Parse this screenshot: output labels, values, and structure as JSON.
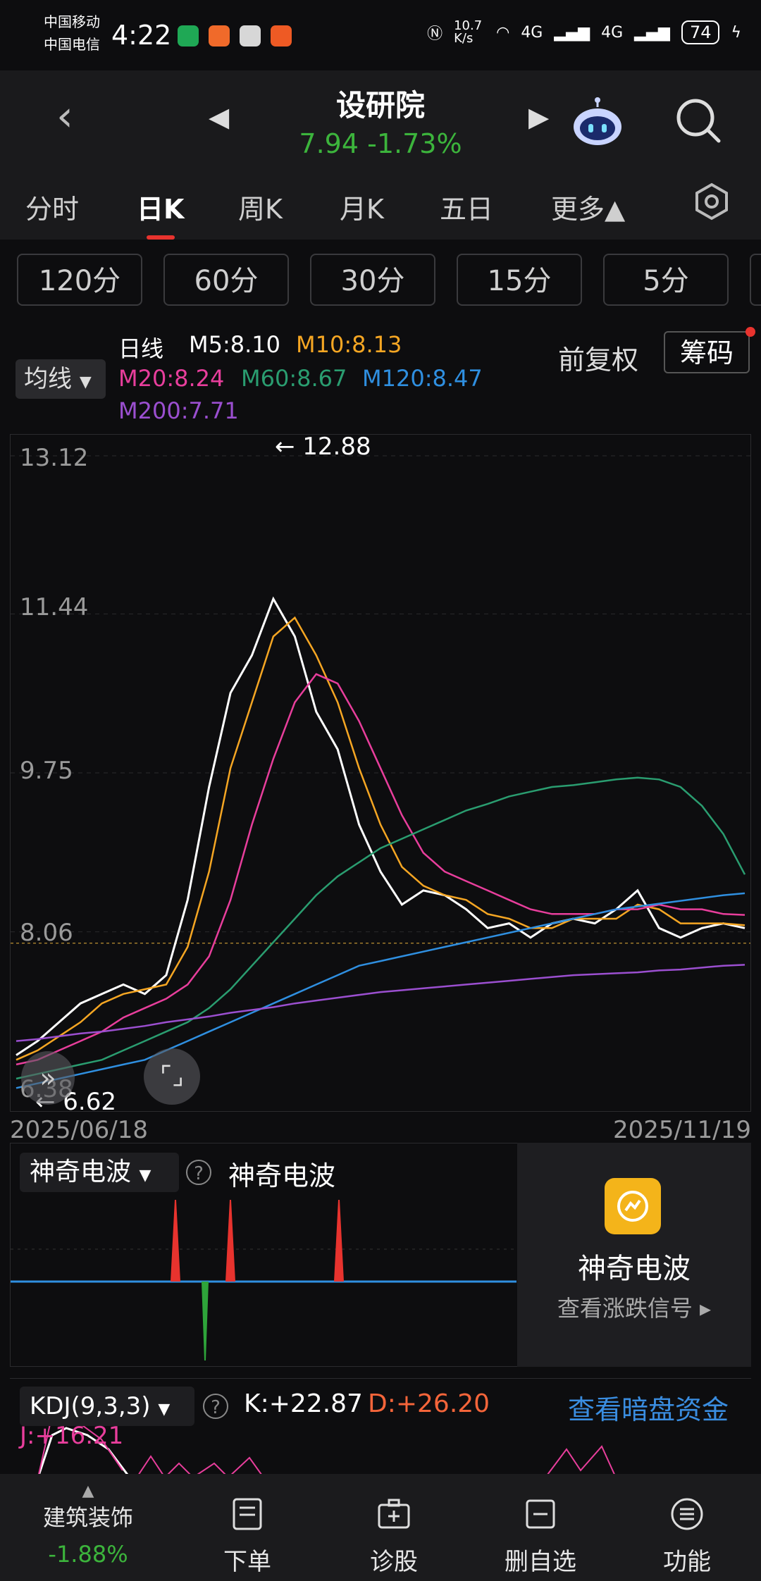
{
  "status_bar": {
    "carrier1": "中国移动",
    "carrier2": "中国电信",
    "time": "4:22",
    "net_speed": "10.7 K/s",
    "signal1": "4G",
    "signal2": "4G",
    "battery": "74"
  },
  "header": {
    "title": "设研院",
    "price": "7.94",
    "change": "-1.73%",
    "change_color": "#3cb43c"
  },
  "period_tabs": [
    "分时",
    "日K",
    "周K",
    "月K",
    "五日",
    "更多▲"
  ],
  "active_tab": "日K",
  "minute_buttons": [
    "120分",
    "60分",
    "30分",
    "15分",
    "5分"
  ],
  "legend": {
    "selector": "均线",
    "label": "日线",
    "m5": "M5:8.10",
    "m10": "M10:8.13",
    "m20": "M20:8.24",
    "m60": "M60:8.67",
    "m120": "M120:8.47",
    "m200": "M200:7.71",
    "adjust": "前复权",
    "chips": "筹码"
  },
  "chart_data": {
    "type": "line",
    "title": "",
    "y_ticks": [
      "13.12",
      "11.44",
      "9.75",
      "8.06",
      "6.38"
    ],
    "ylim": [
      6.38,
      13.12
    ],
    "x_start": "2025/06/18",
    "x_end": "2025/11/19",
    "high_annotation": "12.88",
    "low_annotation": "6.62",
    "last_price": 7.94,
    "series": [
      {
        "name": "M5",
        "color": "#ffffff",
        "values": [
          6.75,
          6.9,
          7.1,
          7.3,
          7.4,
          7.5,
          7.4,
          7.6,
          8.4,
          9.6,
          10.6,
          11.0,
          11.6,
          11.2,
          10.4,
          10.0,
          9.2,
          8.7,
          8.35,
          8.5,
          8.45,
          8.3,
          8.1,
          8.15,
          8.0,
          8.15,
          8.2,
          8.15,
          8.3,
          8.5,
          8.1,
          8.0,
          8.1,
          8.15,
          8.1
        ]
      },
      {
        "name": "M10",
        "color": "#f5a623",
        "values": [
          6.7,
          6.8,
          6.95,
          7.1,
          7.3,
          7.4,
          7.45,
          7.5,
          7.9,
          8.7,
          9.8,
          10.5,
          11.2,
          11.4,
          11.0,
          10.5,
          9.8,
          9.2,
          8.75,
          8.55,
          8.45,
          8.4,
          8.25,
          8.2,
          8.1,
          8.1,
          8.2,
          8.2,
          8.2,
          8.35,
          8.3,
          8.15,
          8.15,
          8.15,
          8.13
        ]
      },
      {
        "name": "M20",
        "color": "#e83e9c",
        "values": [
          6.65,
          6.7,
          6.8,
          6.9,
          7.0,
          7.15,
          7.25,
          7.35,
          7.5,
          7.8,
          8.4,
          9.2,
          9.9,
          10.5,
          10.8,
          10.7,
          10.3,
          9.8,
          9.3,
          8.9,
          8.7,
          8.6,
          8.5,
          8.4,
          8.3,
          8.25,
          8.25,
          8.25,
          8.3,
          8.3,
          8.35,
          8.3,
          8.3,
          8.25,
          8.24
        ]
      },
      {
        "name": "M60",
        "color": "#2a9d70",
        "values": [
          6.5,
          6.55,
          6.6,
          6.65,
          6.7,
          6.8,
          6.9,
          7.0,
          7.1,
          7.25,
          7.45,
          7.7,
          7.95,
          8.2,
          8.45,
          8.65,
          8.8,
          8.95,
          9.05,
          9.15,
          9.25,
          9.35,
          9.42,
          9.5,
          9.55,
          9.6,
          9.62,
          9.65,
          9.68,
          9.7,
          9.68,
          9.6,
          9.4,
          9.1,
          8.67
        ]
      },
      {
        "name": "M120",
        "color": "#2f8fe0",
        "values": [
          6.4,
          6.45,
          6.5,
          6.55,
          6.6,
          6.65,
          6.7,
          6.8,
          6.9,
          7.0,
          7.1,
          7.2,
          7.3,
          7.4,
          7.5,
          7.6,
          7.7,
          7.75,
          7.8,
          7.85,
          7.9,
          7.95,
          8.0,
          8.05,
          8.1,
          8.15,
          8.2,
          8.25,
          8.3,
          8.33,
          8.36,
          8.39,
          8.42,
          8.45,
          8.47
        ]
      },
      {
        "name": "M200",
        "color": "#9b4fd0",
        "values": [
          6.9,
          6.92,
          6.95,
          6.98,
          7.0,
          7.03,
          7.06,
          7.1,
          7.13,
          7.16,
          7.2,
          7.23,
          7.26,
          7.3,
          7.33,
          7.36,
          7.39,
          7.42,
          7.44,
          7.46,
          7.48,
          7.5,
          7.52,
          7.54,
          7.56,
          7.58,
          7.6,
          7.61,
          7.62,
          7.63,
          7.65,
          7.66,
          7.68,
          7.7,
          7.71
        ]
      }
    ]
  },
  "wave": {
    "selector": "神奇电波",
    "label": "神奇电波",
    "card_title": "神奇电波",
    "card_link": "查看涨跌信号 ▸"
  },
  "kdj": {
    "selector": "KDJ(9,3,3)",
    "k": "K:+22.87",
    "d": "D:+26.20",
    "j": "J:+16.21",
    "link": "查看暗盘资金"
  },
  "bottom_nav": {
    "sector": "建筑装饰",
    "sector_change": "-1.88%",
    "order": "下单",
    "diagnose": "诊股",
    "remove_watch": "删自选",
    "functions": "功能"
  }
}
